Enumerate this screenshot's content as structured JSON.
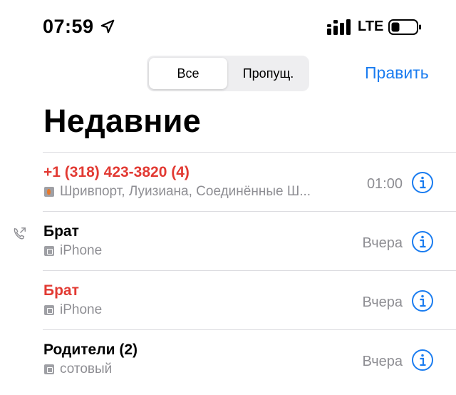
{
  "status_bar": {
    "time": "07:59",
    "carrier": "LTE",
    "icons": [
      "location-arrow-icon",
      "signal-bars-icon",
      "battery-icon"
    ]
  },
  "segmented_control": {
    "options": [
      "Все",
      "Пропущ."
    ],
    "selected": "Все"
  },
  "header": {
    "edit_label": "Править",
    "title": "Недавние"
  },
  "calls": [
    {
      "name": "+1 (318) 423-3820 (4)",
      "missed": true,
      "subtitle": "Шривпорт, Луизиана, Соединённые Ш...",
      "sub_icon": "flag-icon",
      "time": "01:00",
      "outgoing": false
    },
    {
      "name": "Брат",
      "missed": false,
      "subtitle": "iPhone",
      "sub_icon": "phone-type-icon",
      "time": "Вчера",
      "outgoing": true
    },
    {
      "name": "Брат",
      "missed": true,
      "subtitle": "iPhone",
      "sub_icon": "phone-type-icon",
      "time": "Вчера",
      "outgoing": false
    },
    {
      "name": "Родители (2)",
      "missed": false,
      "subtitle": "сотовый",
      "sub_icon": "phone-type-icon",
      "time": "Вчера",
      "outgoing": false
    }
  ],
  "colors": {
    "accent": "#1a7cf0",
    "missed": "#e23a33",
    "secondary_text": "#8e8e93"
  }
}
